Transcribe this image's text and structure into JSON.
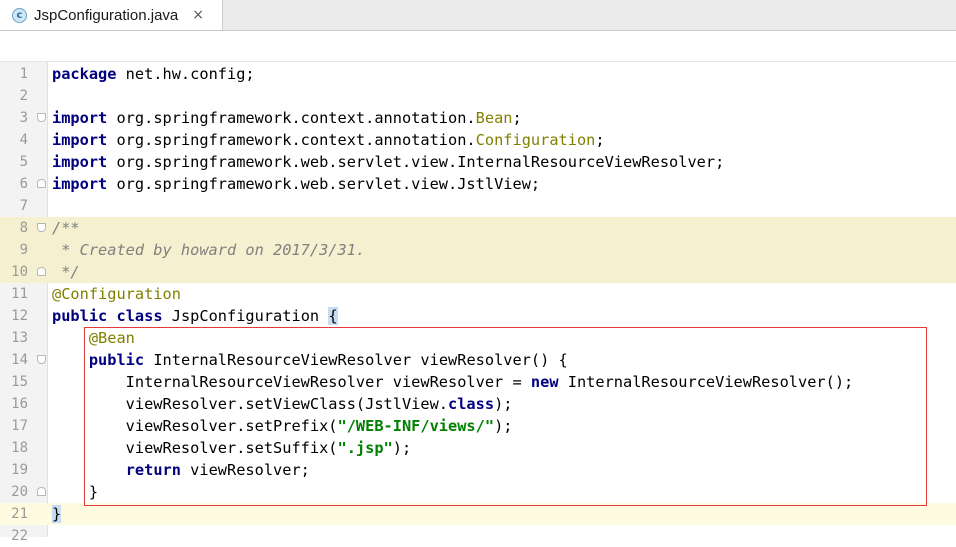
{
  "tab": {
    "icon_letter": "c",
    "title": "JspConfiguration.java",
    "close_symbol": "×"
  },
  "editor": {
    "lines": [
      {
        "n": "1",
        "tokens": [
          {
            "t": "package",
            "c": "kw"
          },
          {
            "t": " net.hw.config;",
            "c": ""
          }
        ]
      },
      {
        "n": "2",
        "tokens": []
      },
      {
        "n": "3",
        "tokens": [
          {
            "t": "import",
            "c": "kw"
          },
          {
            "t": " org.springframework.context.annotation.",
            "c": ""
          },
          {
            "t": "Bean",
            "c": "cls"
          },
          {
            "t": ";",
            "c": ""
          }
        ],
        "fold": "open"
      },
      {
        "n": "4",
        "tokens": [
          {
            "t": "import",
            "c": "kw"
          },
          {
            "t": " org.springframework.context.annotation.",
            "c": ""
          },
          {
            "t": "Configuration",
            "c": "cls"
          },
          {
            "t": ";",
            "c": ""
          }
        ]
      },
      {
        "n": "5",
        "tokens": [
          {
            "t": "import",
            "c": "kw"
          },
          {
            "t": " org.springframework.web.servlet.view.InternalResourceViewResolver;",
            "c": ""
          }
        ]
      },
      {
        "n": "6",
        "tokens": [
          {
            "t": "import",
            "c": "kw"
          },
          {
            "t": " org.springframework.web.servlet.view.JstlView;",
            "c": ""
          }
        ],
        "fold": "close"
      },
      {
        "n": "7",
        "tokens": []
      },
      {
        "n": "8",
        "tokens": [
          {
            "t": "/**",
            "c": "cm"
          }
        ],
        "hl": true,
        "fold": "open"
      },
      {
        "n": "9",
        "tokens": [
          {
            "t": " * Created by howard on 2017/3/31.",
            "c": "cm"
          }
        ],
        "hl": true
      },
      {
        "n": "10",
        "tokens": [
          {
            "t": " */",
            "c": "cm"
          }
        ],
        "hl": true,
        "fold": "close"
      },
      {
        "n": "11",
        "tokens": [
          {
            "t": "@Configuration",
            "c": "ann"
          }
        ]
      },
      {
        "n": "12",
        "tokens": [
          {
            "t": "public",
            "c": "kw"
          },
          {
            "t": " ",
            "c": ""
          },
          {
            "t": "class",
            "c": "kw"
          },
          {
            "t": " JspConfiguration ",
            "c": ""
          },
          {
            "t": "{",
            "c": "brace-hl"
          }
        ]
      },
      {
        "n": "13",
        "tokens": [
          {
            "t": "    ",
            "c": ""
          },
          {
            "t": "@Bean",
            "c": "ann"
          }
        ]
      },
      {
        "n": "14",
        "tokens": [
          {
            "t": "    ",
            "c": ""
          },
          {
            "t": "public",
            "c": "kw"
          },
          {
            "t": " InternalResourceViewResolver viewResolver() {",
            "c": ""
          }
        ],
        "fold": "open"
      },
      {
        "n": "15",
        "tokens": [
          {
            "t": "        InternalResourceViewResolver viewResolver = ",
            "c": ""
          },
          {
            "t": "new",
            "c": "kw"
          },
          {
            "t": " InternalResourceViewResolver();",
            "c": ""
          }
        ]
      },
      {
        "n": "16",
        "tokens": [
          {
            "t": "        viewResolver.setViewClass(JstlView.",
            "c": ""
          },
          {
            "t": "class",
            "c": "kw"
          },
          {
            "t": ");",
            "c": ""
          }
        ]
      },
      {
        "n": "17",
        "tokens": [
          {
            "t": "        viewResolver.setPrefix(",
            "c": ""
          },
          {
            "t": "\"/WEB-INF/views/\"",
            "c": "str"
          },
          {
            "t": ");",
            "c": ""
          }
        ]
      },
      {
        "n": "18",
        "tokens": [
          {
            "t": "        viewResolver.setSuffix(",
            "c": ""
          },
          {
            "t": "\".jsp\"",
            "c": "str"
          },
          {
            "t": ");",
            "c": ""
          }
        ]
      },
      {
        "n": "19",
        "tokens": [
          {
            "t": "        ",
            "c": ""
          },
          {
            "t": "return",
            "c": "kw"
          },
          {
            "t": " viewResolver;",
            "c": ""
          }
        ]
      },
      {
        "n": "20",
        "tokens": [
          {
            "t": "    }",
            "c": ""
          }
        ],
        "fold": "close"
      },
      {
        "n": "21",
        "tokens": [
          {
            "t": "}",
            "c": "brace-hl"
          }
        ],
        "caret": true
      },
      {
        "n": "22",
        "tokens": []
      }
    ]
  },
  "colors": {
    "keyword": "#000080",
    "annotation": "#808000",
    "comment": "#808080",
    "string": "#008000",
    "comment_highlight": "#f5f0cf",
    "selection_box": "#e23b3b"
  }
}
